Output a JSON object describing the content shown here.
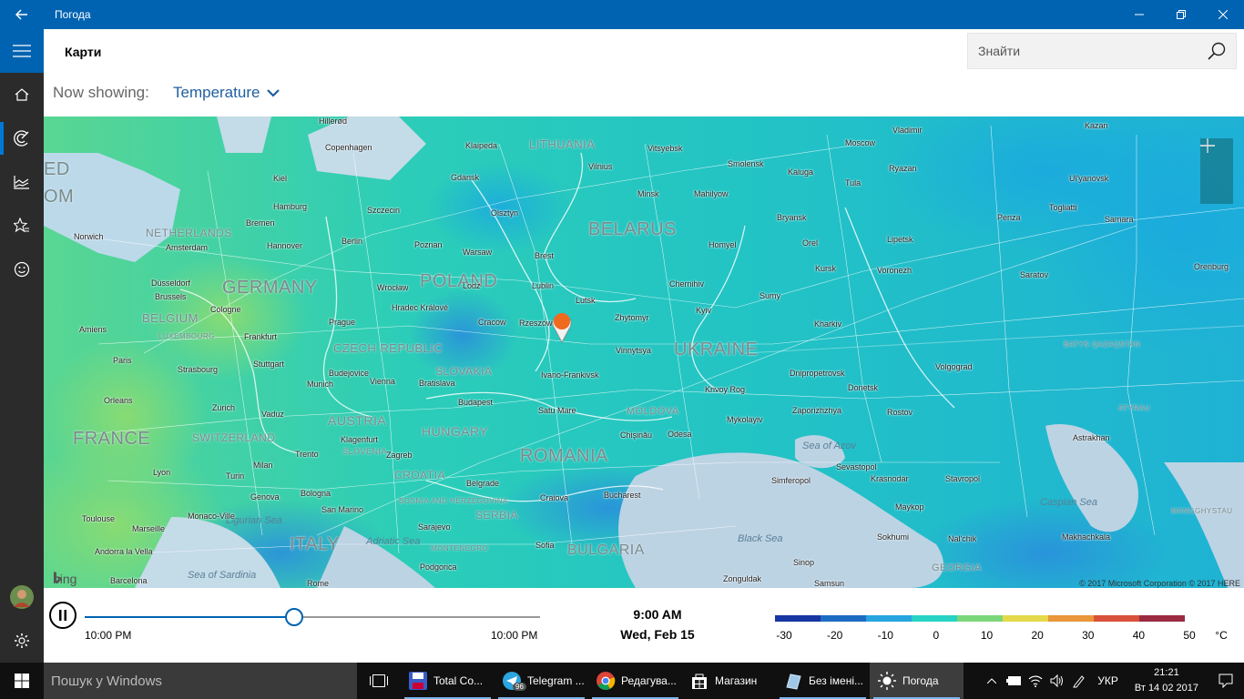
{
  "window": {
    "title": "Погода"
  },
  "header": {
    "page_title": "Карти",
    "search_placeholder": "Знайти",
    "now_showing_label": "Now showing:",
    "layer": "Temperature"
  },
  "map": {
    "countries": [
      "BELARUS",
      "POLAND",
      "GERMANY",
      "UKRAINE",
      "ROMANIA",
      "FRANCE",
      "ITALY",
      "BULGARIA",
      "HUNGARY",
      "AUSTRIA",
      "SLOVAKIA",
      "CZECH REPUBLIC",
      "LITHUANIA",
      "MOLDOVA",
      "SWITZERLAND",
      "BELGIUM",
      "NETHERLANDS",
      "SERBIA",
      "CROATIA",
      "SLOVENIA",
      "GEORGIA",
      "BOSNIA AND HERZEGOVINA",
      "MONTENEGRO",
      "LUXEMBOURG",
      "BATYS QAZAQSTAN",
      "ATYRAU",
      "MANGGHYSTAU",
      "ED",
      "OM"
    ],
    "seas": [
      "Black Sea",
      "Sea of Azov",
      "Caspian Sea",
      "Adriatic Sea",
      "Ligurian Sea",
      "Sea of Sardinia"
    ],
    "cities": [
      "Hillerød",
      "Copenhagen",
      "Klaipeda",
      "Vilnius",
      "Vitsyebsk",
      "Vladimir",
      "Moscow",
      "Kazan",
      "Kiel",
      "Gdansk",
      "Smolensk",
      "Kaluga",
      "Ryazan",
      "Ul'yanovsk",
      "Norwich",
      "Hamburg",
      "Szczecin",
      "Olsztyn",
      "Minsk",
      "Mahilyow",
      "Tula",
      "Bremen",
      "Amsterdam",
      "Hannover",
      "Berlin",
      "Poznan",
      "Warsaw",
      "Bryansk",
      "Penza",
      "Togliatti",
      "Samara",
      "Orel",
      "Lipetsk",
      "Homyel",
      "Brest",
      "Kursk",
      "Voronezh",
      "Saratov",
      "Orenburg",
      "Düsseldorf",
      "Wrocław",
      "Lodz",
      "Lublin",
      "Chernihiv",
      "Brussels",
      "Cologne",
      "Hradec Králové",
      "Lutsk",
      "Sumy",
      "Amiens",
      "Frankfurt",
      "Prague",
      "Cracow",
      "Rzeszów",
      "Zhytomyr",
      "Kyiv",
      "Kharkiv",
      "Paris",
      "Stuttgart",
      "Strasbourg",
      "Ivano-Frankivsk",
      "Vinnytsya",
      "Budejovice",
      "Munich",
      "Vienna",
      "Bratislava",
      "Dnipropetrovsk",
      "Volgograd",
      "Orleans",
      "Zurich",
      "Vaduz",
      "Budapest",
      "Satu Mare",
      "Krivoy Rog",
      "Donetsk",
      "Zaporizhzhya",
      "Rostov",
      "Chişinău",
      "Mykolayiv",
      "Odesa",
      "Klagenfurt",
      "Trento",
      "Astrakhan",
      "Lyon",
      "Milan",
      "Turin",
      "Zagreb",
      "Genova",
      "Bologna",
      "Belgrade",
      "Krasnodar",
      "Stavropol",
      "Simferopol",
      "Craiova",
      "Bucharest",
      "Maykop",
      "Sarajevo",
      "Toulouse",
      "Marseille",
      "Monaco-Ville",
      "San Marino",
      "Sokhumi",
      "Nal'chik",
      "Makhachkala",
      "Andorra la Vella",
      "Podgorica",
      "Sofia",
      "Sinop",
      "Barcelona",
      "Rome",
      "Zonguldak",
      "Samsun",
      "Sevastopol"
    ],
    "copyright": "© 2017 Microsoft Corporation   © 2017 HERE",
    "bing": "bing"
  },
  "timeline": {
    "start": "10:00 PM",
    "end": "10:00 PM",
    "current_time": "9:00 AM",
    "current_date": "Wed, Feb 15",
    "position": 0.46
  },
  "legend": {
    "labels": [
      "-30",
      "-20",
      "-10",
      "0",
      "10",
      "20",
      "30",
      "40",
      "50"
    ],
    "unit": "°C",
    "colors": [
      "#1736a3",
      "#1d6cc3",
      "#26a5de",
      "#28d3c6",
      "#7bd77a",
      "#e4d94a",
      "#ea963a",
      "#d9513b",
      "#9c2b42"
    ]
  },
  "taskbar": {
    "search": "Пошук у Windows",
    "apps": [
      {
        "label": "Total Co..."
      },
      {
        "label": "Telegram ...",
        "badge": "96"
      },
      {
        "label": "Редагува..."
      },
      {
        "label": "Магазин"
      },
      {
        "label": "Без імені..."
      },
      {
        "label": "Погода"
      }
    ],
    "lang": "УКР",
    "time": "21:21",
    "date": "Вт 14 02 2017"
  }
}
